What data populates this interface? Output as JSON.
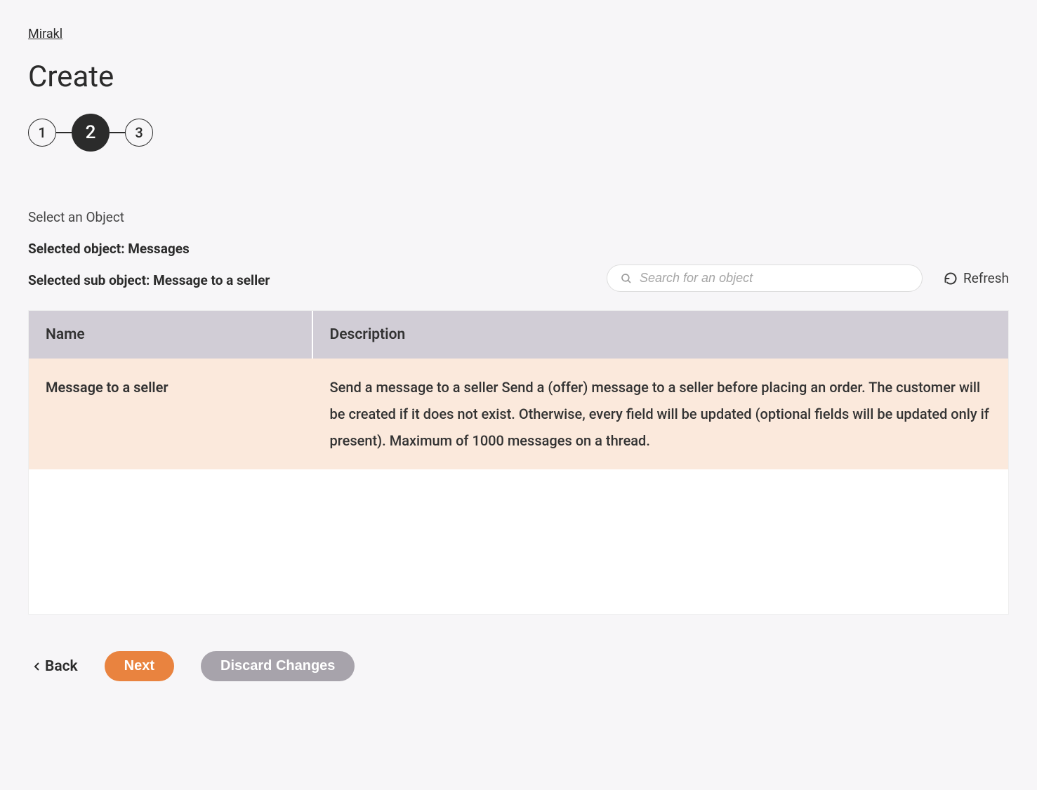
{
  "breadcrumb": {
    "label": "Mirakl"
  },
  "page": {
    "title": "Create"
  },
  "stepper": {
    "steps": [
      {
        "label": "1",
        "active": false
      },
      {
        "label": "2",
        "active": true
      },
      {
        "label": "3",
        "active": false
      }
    ]
  },
  "section": {
    "label": "Select an Object"
  },
  "selection": {
    "object_label": "Selected object: Messages",
    "sub_object_label": "Selected sub object: Message to a seller"
  },
  "search": {
    "placeholder": "Search for an object"
  },
  "refresh": {
    "label": "Refresh"
  },
  "table": {
    "columns": {
      "name": "Name",
      "description": "Description"
    },
    "rows": [
      {
        "name": "Message to a seller",
        "description": "Send a message to a seller Send a (offer) message to a seller before placing an order. The customer will be created if it does not exist. Otherwise, every field will be updated (optional fields will be updated only if present). Maximum of 1000 messages on a thread.",
        "selected": true
      }
    ]
  },
  "footer": {
    "back": "Back",
    "next": "Next",
    "discard": "Discard Changes"
  }
}
